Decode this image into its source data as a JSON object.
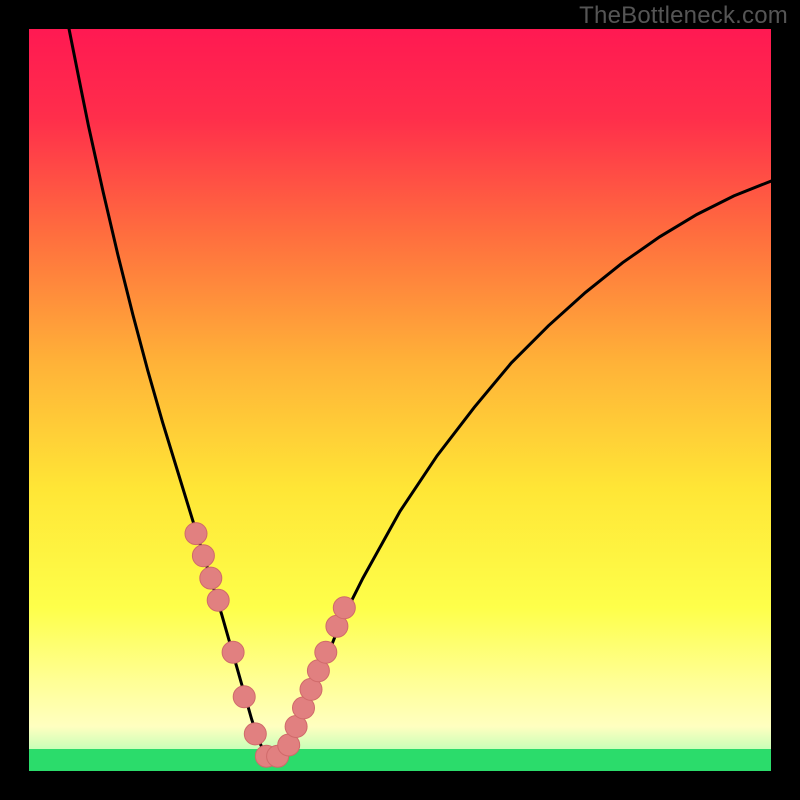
{
  "watermark": "TheBottleneck.com",
  "colors": {
    "frame": "#000000",
    "curve": "#000000",
    "markers_fill": "#e18080",
    "markers_stroke": "#d06a6a",
    "green_band": "#2bdc6b",
    "gradient_top": "#ff1952",
    "gradient_mid1": "#ff943a",
    "gradient_mid2": "#ffe636",
    "gradient_low": "#ffff96",
    "gradient_green": "#2bdc6b"
  },
  "chart_data": {
    "type": "line",
    "title": "",
    "xlabel": "",
    "ylabel": "",
    "xlim": [
      0,
      100
    ],
    "ylim": [
      0,
      100
    ],
    "note": "Values estimated from pixel positions; chart has no numeric tick labels.",
    "series": [
      {
        "name": "bottleneck-curve",
        "x": [
          5,
          6,
          7,
          8,
          9,
          10,
          12,
          14,
          16,
          18,
          20,
          22,
          24,
          26,
          27,
          28,
          29,
          30,
          31,
          32,
          33,
          34,
          36,
          38,
          40,
          42,
          45,
          50,
          55,
          60,
          65,
          70,
          75,
          80,
          85,
          90,
          95,
          100
        ],
        "y": [
          102,
          97,
          92,
          87,
          82.5,
          78,
          69.5,
          61.5,
          54,
          47,
          40.5,
          34,
          27.5,
          21,
          17.5,
          14,
          10.5,
          7,
          4,
          2,
          1,
          1.5,
          5,
          10,
          15,
          20,
          26,
          35,
          42.5,
          49,
          55,
          60,
          64.5,
          68.5,
          72,
          75,
          77.5,
          79.5
        ]
      }
    ],
    "markers": {
      "name": "highlighted-points",
      "x": [
        22.5,
        23.5,
        24.5,
        25.5,
        27.5,
        29.0,
        30.5,
        32.0,
        33.5,
        35.0,
        36.0,
        37.0,
        38.0,
        39.0,
        40.0,
        41.5,
        42.5
      ],
      "y": [
        32.0,
        29.0,
        26.0,
        23.0,
        16.0,
        10.0,
        5.0,
        2.0,
        2.0,
        3.5,
        6.0,
        8.5,
        11.0,
        13.5,
        16.0,
        19.5,
        22.0
      ]
    },
    "green_band_y": [
      0,
      3
    ]
  }
}
